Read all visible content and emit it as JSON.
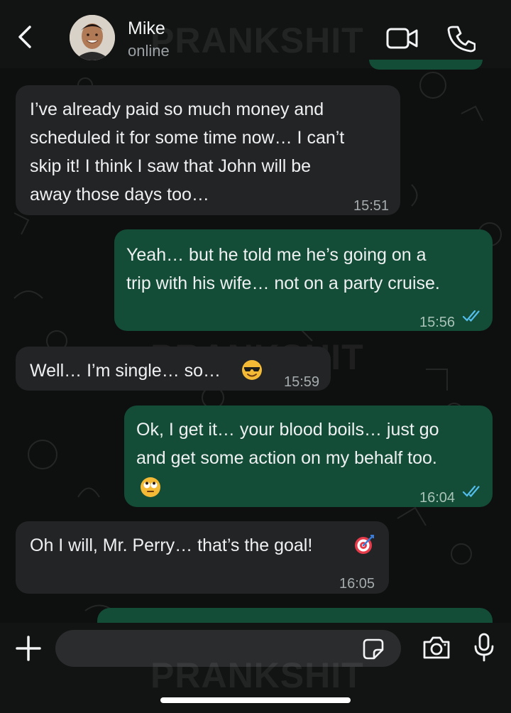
{
  "header": {
    "contact_name": "Mike",
    "status": "online",
    "watermark": "PRANKSHIT"
  },
  "messages": [
    {
      "direction": "in",
      "lines": [
        "I’ve already paid so much money and",
        "scheduled it for some time now… I can’t",
        "skip it! I think I saw that John will be",
        "away those days too…"
      ],
      "time": "15:51"
    },
    {
      "direction": "out",
      "lines": [
        "Yeah… but he told me he’s going on a",
        "trip with his wife… not on a party cruise."
      ],
      "time": "15:56",
      "read": true
    },
    {
      "direction": "in",
      "lines": [
        "Well… I’m single… so…"
      ],
      "emoji": "smiling-face-with-sunglasses",
      "time": "15:59"
    },
    {
      "direction": "out",
      "lines": [
        "Ok, I get it… your blood boils… just go",
        "and get some action on my behalf too."
      ],
      "emoji": "face-with-rolling-eyes",
      "time": "16:04",
      "read": true
    },
    {
      "direction": "in",
      "lines": [
        "Oh I will, Mr. Perry… that’s the goal!"
      ],
      "emoji": "direct-hit",
      "time": "16:05"
    }
  ],
  "composer": {
    "placeholder": ""
  },
  "colors": {
    "incoming_bubble": "#222425",
    "outgoing_bubble": "#134d37",
    "read_ticks": "#53bdeb",
    "header_bg": "#121313"
  }
}
